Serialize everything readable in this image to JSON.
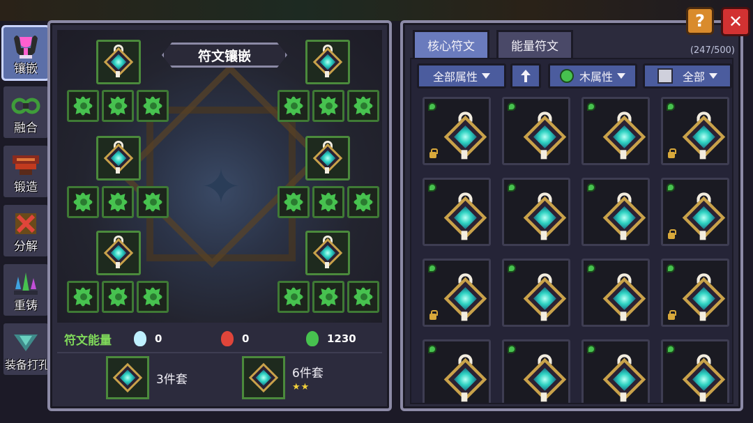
{
  "header": {
    "help_label": "?",
    "close_label": "✕"
  },
  "side_tabs": [
    {
      "label": "镶嵌",
      "active": true,
      "icon": "pink-goblet-icon"
    },
    {
      "label": "融合",
      "active": false,
      "icon": "green-rings-icon"
    },
    {
      "label": "锻造",
      "active": false,
      "icon": "anvil-icon"
    },
    {
      "label": "分解",
      "active": false,
      "icon": "red-cross-icon"
    },
    {
      "label": "重铸",
      "active": false,
      "icon": "crystals-icon"
    },
    {
      "label": "装备打孔",
      "active": false,
      "icon": "drill-icon"
    }
  ],
  "left_panel": {
    "title": "符文镶嵌",
    "energy": {
      "label": "符文能量",
      "items": [
        {
          "icon": "water-drop-icon",
          "color": "#bff0ff",
          "value": "0"
        },
        {
          "icon": "fire-icon",
          "color": "#e0453a",
          "value": "0"
        },
        {
          "icon": "wood-leaf-icon",
          "color": "#47c24f",
          "value": "1230"
        }
      ]
    },
    "sets": [
      {
        "label": "3件套",
        "stars": ""
      },
      {
        "label": "6件套",
        "stars": "★★"
      }
    ]
  },
  "right_panel": {
    "tabs": [
      {
        "label": "核心符文",
        "active": true
      },
      {
        "label": "能量符文",
        "active": false
      }
    ],
    "count": "(247/500)",
    "filters": {
      "attribute_all": "全部属性",
      "sort_icon": "up-arrow-icon",
      "element": "木属性",
      "quality": "全部"
    }
  },
  "colors": {
    "accent_green": "#47c24f",
    "panel_border": "#8c8aa6",
    "tab_active": "#6a7bbd",
    "close_red": "#d23232",
    "help_orange": "#d98b2c"
  }
}
